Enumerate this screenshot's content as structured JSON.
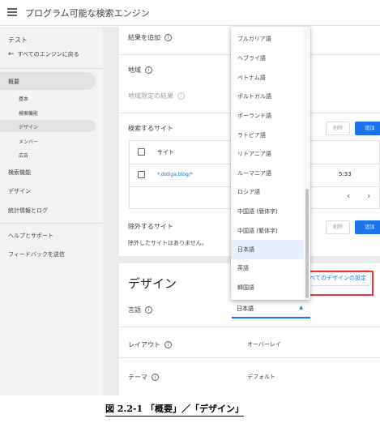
{
  "header": {
    "title": "プログラム可能な検索エンジン"
  },
  "sidebar": {
    "engine_name": "テスト",
    "back_label": "すべてのエンジンに戻る",
    "items": [
      {
        "label": "概要"
      },
      {
        "label": "基本"
      },
      {
        "label": "検索機能"
      },
      {
        "label": "デザイン"
      },
      {
        "label": "メンバー"
      },
      {
        "label": "広告"
      },
      {
        "label": "検索機能"
      },
      {
        "label": "デザイン"
      },
      {
        "label": "統計情報とログ"
      },
      {
        "label": "ヘルプとサポート"
      },
      {
        "label": "フィードバックを送信"
      }
    ]
  },
  "overview": {
    "add_results_label": "結果を追加",
    "region_label": "地域",
    "region_results_label": "地域限定の結果",
    "sites_label": "検索するサイト",
    "delete_label": "削除",
    "add_label": "追加",
    "table_header_site": "サイト",
    "table_row_site": "*.dotiga.blog/*",
    "table_row_time": "5:33",
    "exclude_label": "除外するサイト",
    "exclude_empty": "除外したサイトはありません。"
  },
  "design": {
    "title": "デザイン",
    "all_design_settings": "すべてのデザインの設定",
    "language_label": "言語",
    "language_value": "日本語",
    "layout_label": "レイアウト",
    "layout_value": "オーバーレイ",
    "theme_label": "テーマ",
    "theme_value": "デフォルト"
  },
  "dropdown": {
    "options": [
      "ブルガリア語",
      "ヘブライ語",
      "ベトナム語",
      "ポルトガル語",
      "ポーランド語",
      "ラトビア語",
      "リトアニア語",
      "ルーマニア語",
      "ロシア語",
      "中国語 (簡体字)",
      "中国語 (繁体字)",
      "日本語",
      "英語",
      "韓国語"
    ],
    "selected": "日本語"
  },
  "caption": "図 2.2-1 「概要」／「デザイン」",
  "colors": {
    "accent": "#1a73e8",
    "highlight": "#e53935",
    "selected_bg": "#e8f0fe"
  }
}
